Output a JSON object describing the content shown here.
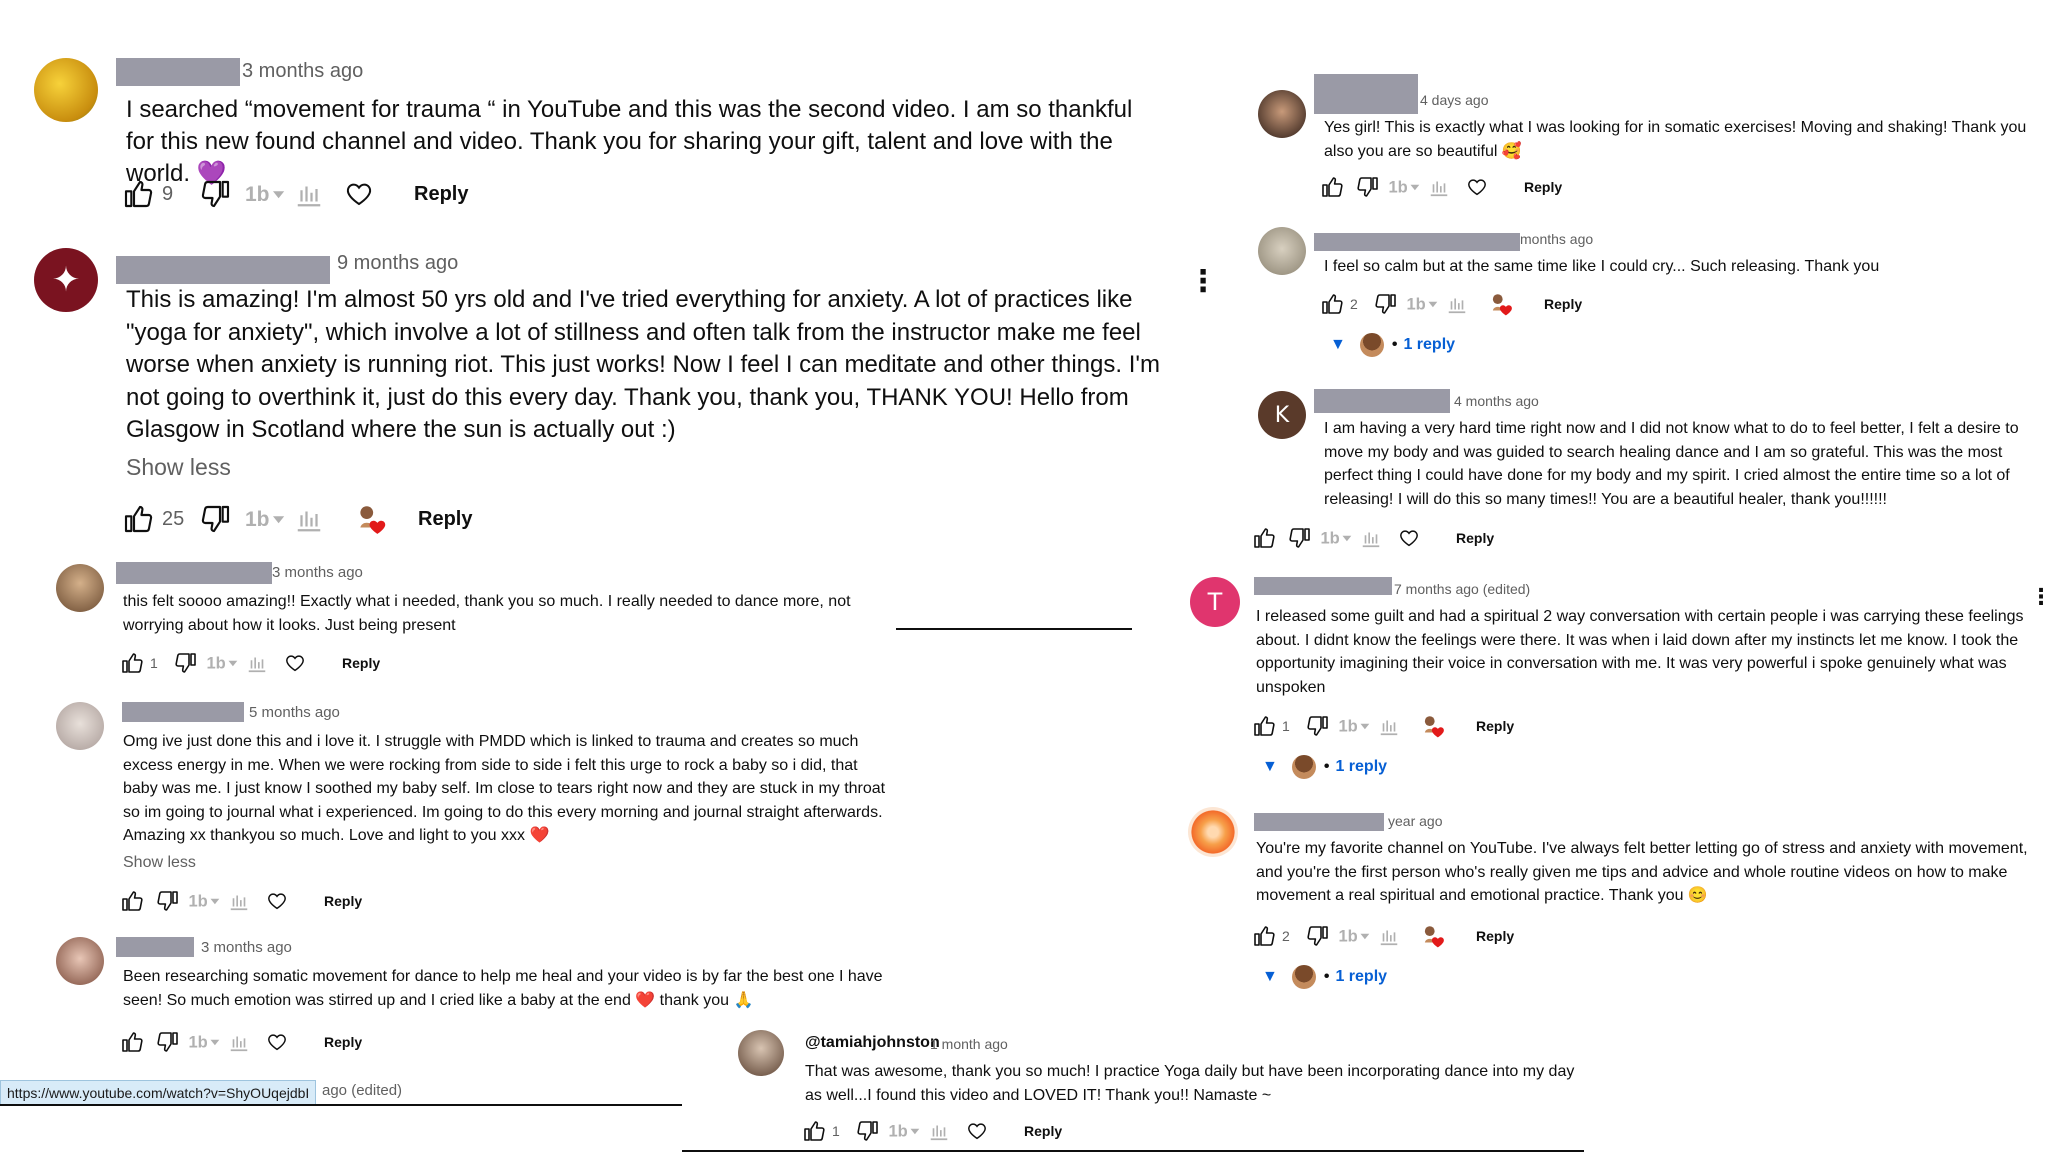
{
  "colors": {
    "link_blue": "#065fd4",
    "redaction_grey": "#9a9aa6",
    "meta_grey": "#606060"
  },
  "icons": {
    "like": "thumbs-up-icon",
    "dislike": "thumbs-down-icon",
    "translate": "translate-icon",
    "stats": "bar-chart-icon",
    "heart": "heart-icon",
    "more": "more-vert-icon",
    "expand": "caret-down-icon"
  },
  "left_column": {
    "c1": {
      "time": "3 months ago",
      "text": "I searched “movement for trauma “ in YouTube and this was the second video. I am so thankful for  this new found channel and video. Thank you for sharing your gift, talent and love with the world. 💜",
      "likes": "9",
      "reply_label": "Reply"
    },
    "c2": {
      "time": "9 months ago",
      "text": "This is amazing!  I'm almost 50 yrs old and I've tried everything for anxiety. A lot of practices like \"yoga for anxiety\", which involve a lot of stillness and often talk from the instructor make me feel worse when anxiety is running riot. This just works!  Now I feel I can meditate and other things. I'm not going to overthink it, just do this every day. Thank you, thank you, THANK  YOU! Hello from Glasgow in Scotland where the sun is actually out :)",
      "show_less": "Show less",
      "likes": "25",
      "reply_label": "Reply",
      "more": "⋮"
    },
    "c3": {
      "time": "3 months ago",
      "text": "this felt soooo amazing!! Exactly what i needed, thank you so much. I really needed to dance more, not worrying about how it looks. Just being present",
      "likes": "1",
      "reply_label": "Reply"
    },
    "c4": {
      "time": "5 months ago",
      "text": "Omg ive just done this and i love it. I struggle with PMDD which is linked to trauma and creates so much excess energy in me. When we were rocking from side to side i felt this urge to rock a baby so i did, that baby was me. I just know I soothed my baby self. Im close to tears right now and they are stuck in my throat so im going to journal what i experienced. Im going to do this every morning and journal straight afterwards. Amazing xx thankyou so much. Love and light to you xxx ❤️",
      "show_less": "Show less",
      "reply_label": "Reply"
    },
    "c5": {
      "time": "3 months ago",
      "text": "Been researching somatic movement for dance to help me heal and your video is by far the best one I have seen! So much emotion was stirred up and I cried like a baby at the end ❤️  thank you 🙏",
      "reply_label": "Reply"
    },
    "status_url": "https://www.youtube.com/watch?v=ShyOUqejdbI",
    "partial_meta": "ago (edited)"
  },
  "bottom_center": {
    "handle": "@tamiahjohnston",
    "time": "1 month ago",
    "text": "That was awesome, thank you so much!  I practice Yoga daily but have been incorporating dance into my day as well...I found this video and LOVED IT!  Thank you!!  Namaste ~",
    "likes": "1",
    "reply_label": "Reply"
  },
  "right_column": {
    "r1": {
      "time": "4 days ago",
      "text": "Yes girl! This is exactly what I was looking for in somatic exercises! Moving and shaking! Thank you also you are so beautiful 🥰",
      "reply_label": "Reply"
    },
    "r2": {
      "time": "months ago",
      "text": "I feel so calm but at the same time like I could cry... Such releasing. Thank you",
      "likes": "2",
      "reply_label": "Reply",
      "replies": "1 reply"
    },
    "r3": {
      "avatar_letter": "K",
      "time": "4 months ago",
      "text": "I am having a very hard time right now and I did not know what to do to feel better, I felt a desire to move my body and was guided to search healing dance and I am so grateful. This was the most perfect thing I could have done for my body and my spirit. I cried almost the entire time so a lot of releasing! I will do this so many times!! You are a beautiful healer, thank you!!!!!!",
      "reply_label": "Reply"
    },
    "r4": {
      "avatar_letter": "T",
      "time": "7 months ago (edited)",
      "text": "I released some guilt and had a spiritual 2 way conversation with certain people i was carrying these feelings about. I didnt know the feelings were there. It was when i laid down after my instincts let me know. I took the opportunity imagining their voice in conversation with me. It was very powerful i spoke genuinely what was unspoken",
      "likes": "1",
      "reply_label": "Reply",
      "replies": "1 reply",
      "more": "⋮"
    },
    "r5": {
      "time": "year ago",
      "text": "You're my favorite channel on YouTube. I've always felt better letting go of stress and anxiety with movement, and you're the first person who's really given me tips and advice and whole routine videos on how to make movement a real spiritual and emotional practice. Thank you 😊",
      "likes": "2",
      "reply_label": "Reply",
      "replies": "1 reply"
    }
  }
}
